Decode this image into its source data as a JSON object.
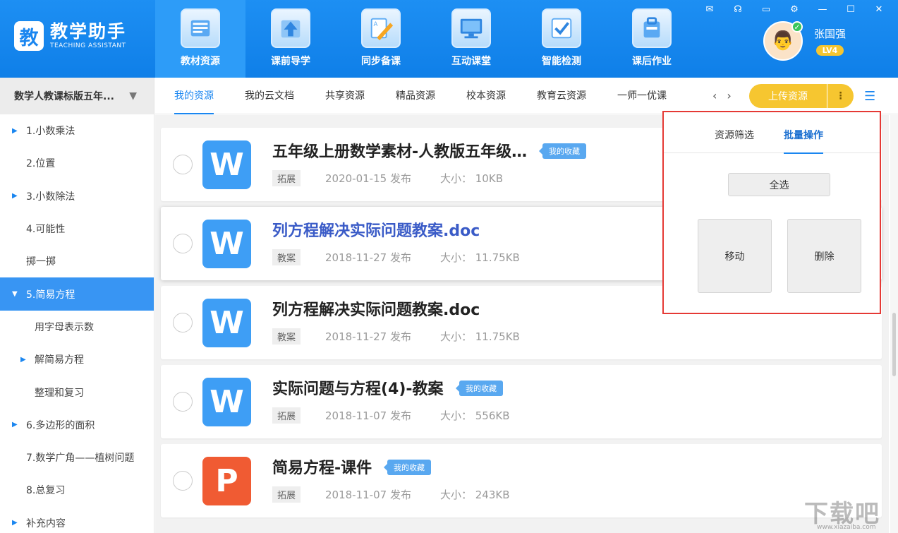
{
  "app": {
    "logo_badge": "教",
    "title": "教学助手",
    "subtitle": "TEACHING ASSISTANT"
  },
  "nav": [
    {
      "label": "教材资源",
      "icon": "folder-icon",
      "active": true
    },
    {
      "label": "课前导学",
      "icon": "upload-arrow-icon",
      "active": false
    },
    {
      "label": "同步备课",
      "icon": "pencil-doc-icon",
      "active": false
    },
    {
      "label": "互动课堂",
      "icon": "monitor-icon",
      "active": false
    },
    {
      "label": "智能检测",
      "icon": "checklist-icon",
      "active": false
    },
    {
      "label": "课后作业",
      "icon": "bag-icon",
      "active": false
    }
  ],
  "window_controls": [
    "mail-icon",
    "headset-icon",
    "screen-icon",
    "gear-icon",
    "minimize-icon",
    "maximize-icon",
    "close-icon"
  ],
  "user": {
    "name": "张国强",
    "level": "LV4"
  },
  "sidebar": {
    "book": "数学人教课标版五年...",
    "items": [
      {
        "label": "1.小数乘法",
        "arrow": "right",
        "indent": 1,
        "active": false
      },
      {
        "label": "2.位置",
        "arrow": "",
        "indent": 1,
        "active": false
      },
      {
        "label": "3.小数除法",
        "arrow": "right",
        "indent": 1,
        "active": false
      },
      {
        "label": "4.可能性",
        "arrow": "",
        "indent": 1,
        "active": false
      },
      {
        "label": "掷一掷",
        "arrow": "",
        "indent": 1,
        "active": false
      },
      {
        "label": "5.简易方程",
        "arrow": "down",
        "indent": 1,
        "active": true
      },
      {
        "label": "用字母表示数",
        "arrow": "",
        "indent": 2,
        "active": false
      },
      {
        "label": "解简易方程",
        "arrow": "right",
        "indent": 2,
        "active": false
      },
      {
        "label": "整理和复习",
        "arrow": "",
        "indent": 2,
        "active": false
      },
      {
        "label": "6.多边形的面积",
        "arrow": "right",
        "indent": 1,
        "active": false
      },
      {
        "label": "7.数学广角——植树问题",
        "arrow": "",
        "indent": 1,
        "active": false
      },
      {
        "label": "8.总复习",
        "arrow": "",
        "indent": 1,
        "active": false
      },
      {
        "label": "补充内容",
        "arrow": "right",
        "indent": 1,
        "active": false
      }
    ]
  },
  "tabs": [
    {
      "label": "我的资源",
      "active": true
    },
    {
      "label": "我的云文档",
      "active": false
    },
    {
      "label": "共享资源",
      "active": false
    },
    {
      "label": "精品资源",
      "active": false
    },
    {
      "label": "校本资源",
      "active": false
    },
    {
      "label": "教育云资源",
      "active": false
    },
    {
      "label": "一师一优课",
      "active": false
    }
  ],
  "tab_prev": "‹",
  "tab_next": "›",
  "upload": {
    "label": "上传资源",
    "more": "⋮"
  },
  "menu_glyph": "☰",
  "files": [
    {
      "type": "W",
      "title": "五年级上册数学素材-人教版五年级…",
      "fav": "我的收藏",
      "tag": "拓展",
      "date": "2020-01-15 发布",
      "size": "大小： 10KB",
      "highlight": false
    },
    {
      "type": "W",
      "title": "列方程解决实际问题教案.doc",
      "fav": "",
      "tag": "教案",
      "date": "2018-11-27 发布",
      "size": "大小： 11.75KB",
      "highlight": true
    },
    {
      "type": "W",
      "title": "列方程解决实际问题教案.doc",
      "fav": "",
      "tag": "教案",
      "date": "2018-11-27 发布",
      "size": "大小： 11.75KB",
      "highlight": false
    },
    {
      "type": "W",
      "title": "实际问题与方程(4)-教案",
      "fav": "我的收藏",
      "tag": "拓展",
      "date": "2018-11-07 发布",
      "size": "大小： 556KB",
      "highlight": false
    },
    {
      "type": "P",
      "title": "简易方程-课件",
      "fav": "我的收藏",
      "tag": "拓展",
      "date": "2018-11-07 发布",
      "size": "大小： 243KB",
      "highlight": false
    }
  ],
  "panel": {
    "tabs": [
      {
        "label": "资源筛选",
        "active": false
      },
      {
        "label": "批量操作",
        "active": true
      }
    ],
    "select_all": "全选",
    "move": "移动",
    "delete": "删除"
  },
  "watermark": {
    "main": "下载吧",
    "sub": "www.xiazaiba.com"
  },
  "colors": {
    "header": "#1a86f0",
    "accent": "#1a86f0",
    "upload": "#f6c630",
    "active_row": "#3895f3",
    "panel_border": "#e53935"
  }
}
